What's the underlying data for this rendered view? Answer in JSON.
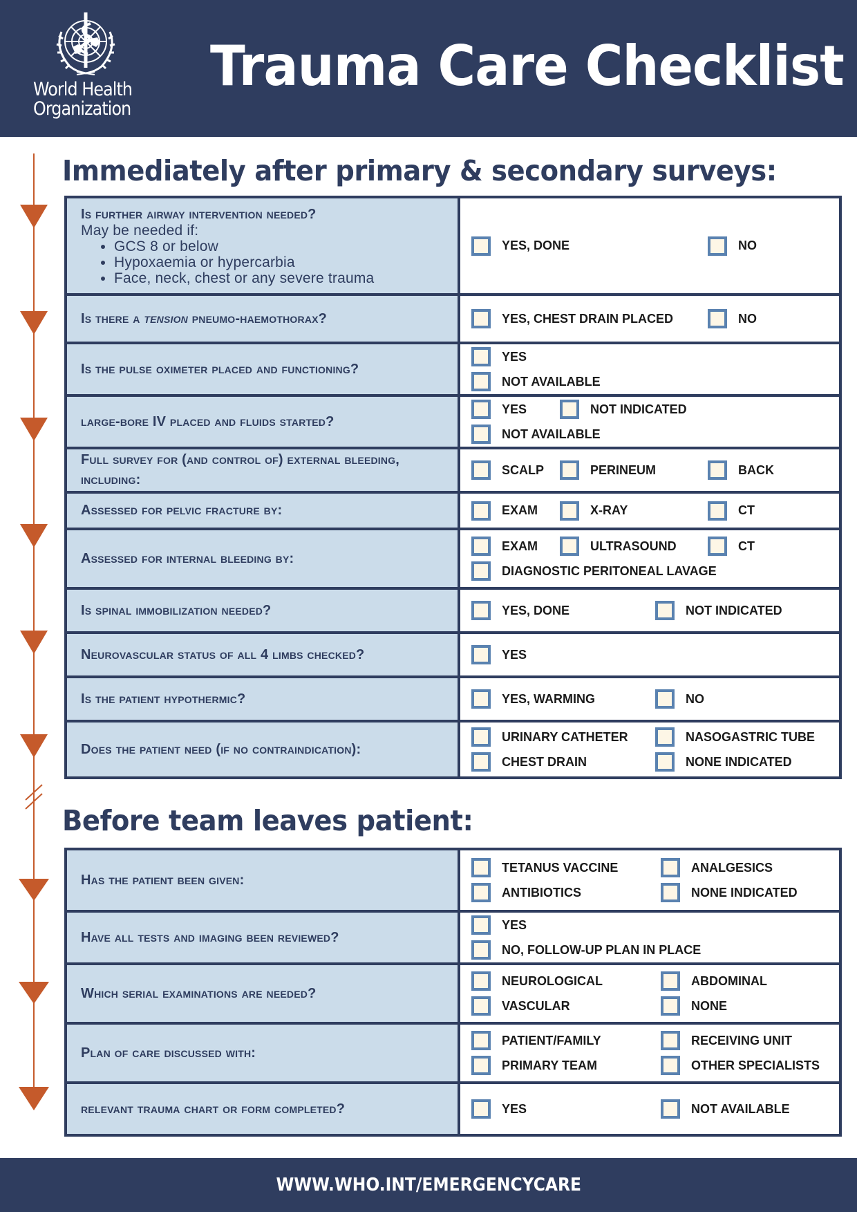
{
  "header": {
    "org_line1": "World Health",
    "org_line2": "Organization",
    "title": "Trauma Care Checklist"
  },
  "colors": {
    "header_bg": "#2f3d5f",
    "question_bg": "#cbdcea",
    "timeline": "#c55a2b",
    "checkbox_border": "#5a82b0",
    "checkbox_fill": "#fdf6e6"
  },
  "section1": {
    "title": "Immediately after primary & secondary surveys:",
    "rows": [
      {
        "question": "Is further airway intervention needed?",
        "note": "May be needed if:",
        "bullets": [
          "GCS 8 or below",
          "Hypoxaemia or hypercarbia",
          "Face, neck, chest or any severe trauma"
        ],
        "options": [
          "YES, DONE",
          "NO"
        ]
      },
      {
        "question": "Is there a",
        "question_em": "tension",
        "question_rest": "pneumo-haemothorax?",
        "options": [
          "YES, CHEST DRAIN PLACED",
          "NO"
        ]
      },
      {
        "question": "Is the pulse oximeter placed and functioning?",
        "options": [
          "YES",
          "NOT AVAILABLE"
        ]
      },
      {
        "question": "large-bore IV placed and fluids started?",
        "options": [
          "YES",
          "NOT INDICATED",
          "NOT AVAILABLE"
        ]
      },
      {
        "question": "Full survey for (and control of) external bleeding, including:",
        "options": [
          "SCALP",
          "PERINEUM",
          "BACK"
        ]
      },
      {
        "question": "Assessed for pelvic fracture by:",
        "options": [
          "EXAM",
          "X-RAY",
          "CT"
        ]
      },
      {
        "question": "Assessed for internal bleeding by:",
        "options": [
          "EXAM",
          "ULTRASOUND",
          "CT",
          "DIAGNOSTIC PERITONEAL LAVAGE"
        ]
      },
      {
        "question": "Is spinal immobilization needed?",
        "options": [
          "YES, DONE",
          "NOT INDICATED"
        ]
      },
      {
        "question": "Neurovascular status of all 4 limbs checked?",
        "options": [
          "YES"
        ]
      },
      {
        "question": "Is the patient hypothermic?",
        "options": [
          "YES, WARMING",
          "NO"
        ]
      },
      {
        "question": "Does the patient need (if no contraindication):",
        "options": [
          "URINARY CATHETER",
          "NASOGASTRIC TUBE",
          "CHEST DRAIN",
          "NONE INDICATED"
        ]
      }
    ]
  },
  "section2": {
    "title": "Before team leaves patient:",
    "rows": [
      {
        "question": "Has the patient been given:",
        "options": [
          "TETANUS VACCINE",
          "ANALGESICS",
          "ANTIBIOTICS",
          "NONE INDICATED"
        ]
      },
      {
        "question": "Have all tests and imaging been reviewed?",
        "options": [
          "YES",
          "NO, FOLLOW-UP PLAN IN PLACE"
        ]
      },
      {
        "question": "Which serial examinations are needed?",
        "options": [
          "NEUROLOGICAL",
          "ABDOMINAL",
          "VASCULAR",
          "NONE"
        ]
      },
      {
        "question": "Plan of care discussed with:",
        "options": [
          "PATIENT/FAMILY",
          "RECEIVING UNIT",
          "PRIMARY TEAM",
          "OTHER SPECIALISTS"
        ]
      },
      {
        "question": "relevant trauma chart or form completed?",
        "options": [
          "YES",
          "NOT AVAILABLE"
        ]
      }
    ]
  },
  "footer": {
    "url": "WWW.WHO.INT/EMERGENCYCARE"
  }
}
